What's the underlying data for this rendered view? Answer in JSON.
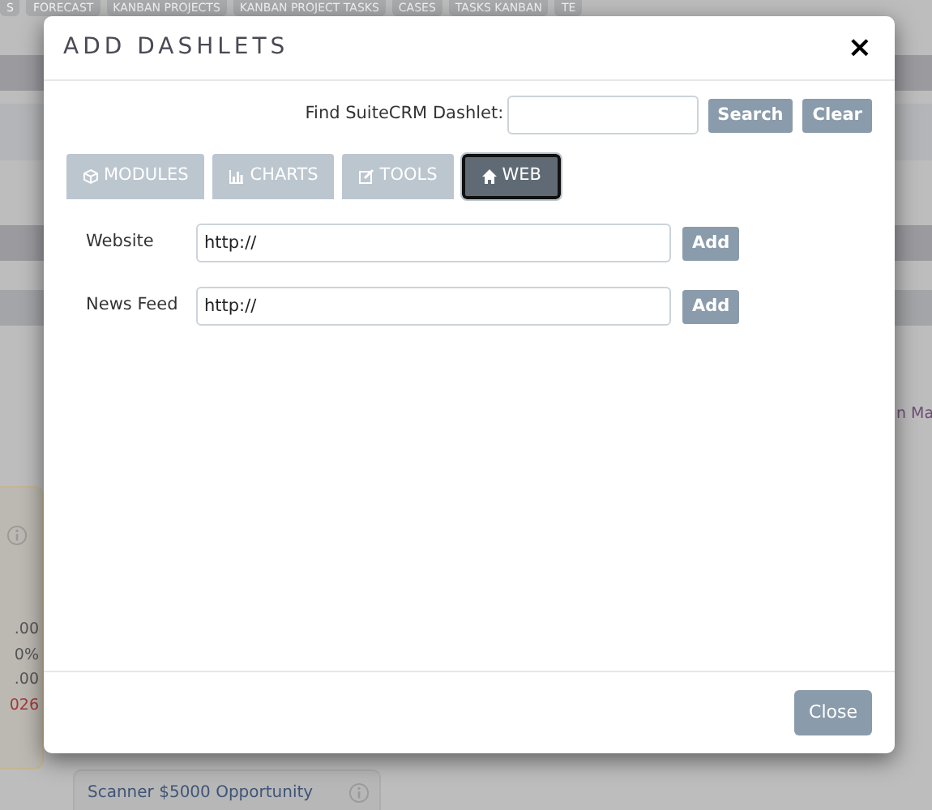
{
  "background": {
    "nav_tabs": [
      "S",
      "FORECAST",
      "KANBAN PROJECTS",
      "KANBAN PROJECT TASKS",
      "CASES",
      "TASKS KANBAN",
      "TE"
    ],
    "side_values": [
      {
        "text": ".00",
        "overdue": false
      },
      {
        "text": "0%",
        "overdue": false
      },
      {
        "text": ".00",
        "overdue": false
      },
      {
        "text": "026",
        "overdue": true
      }
    ],
    "right_text": "n Ma",
    "card_title": "Scanner $5000 Opportunity"
  },
  "dialog": {
    "title": "ADD DASHLETS",
    "close": "×",
    "search": {
      "label": "Find SuiteCRM Dashlet:",
      "buttons": [
        "Search",
        "Clear"
      ]
    },
    "tabs": [
      {
        "label": "MODULES",
        "selected": false
      },
      {
        "label": "CHARTS",
        "selected": false
      },
      {
        "label": "TOOLS",
        "selected": false
      },
      {
        "label": "WEB",
        "selected": true
      }
    ],
    "feeds": [
      {
        "label": "Website",
        "value": "http://",
        "button": "Add"
      },
      {
        "label": "News Feed",
        "value": "http://",
        "button": "Add"
      }
    ],
    "footer_button": "Close"
  }
}
